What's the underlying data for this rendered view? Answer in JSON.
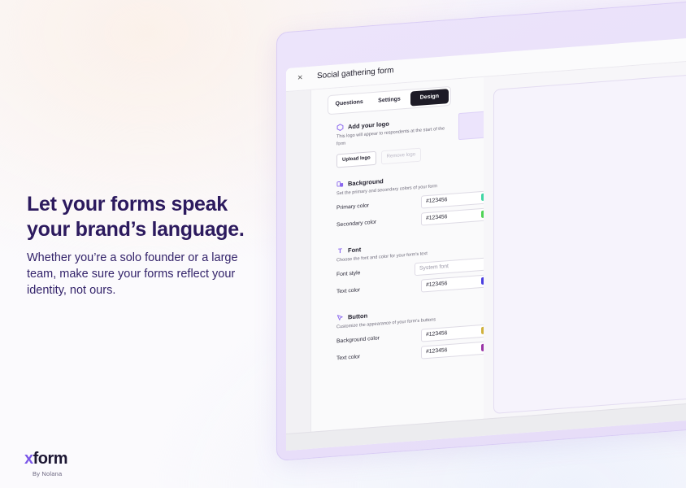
{
  "marketing": {
    "headline_line1": "Let your forms speak",
    "headline_line2": "your brand’s language.",
    "subcopy": "Whether you’re a solo founder or a large team, make sure your forms reflect your identity, not ours."
  },
  "brand": {
    "logo_x": "x",
    "logo_rest": "form",
    "by_text": "By Nolana"
  },
  "window": {
    "close_icon": "×",
    "title": "Social gathering form"
  },
  "tabs": [
    {
      "label": "Questions",
      "active": false
    },
    {
      "label": "Settings",
      "active": false
    },
    {
      "label": "Design",
      "active": true
    }
  ],
  "logo_section": {
    "title": "Add your logo",
    "description": "This logo will appear to respondents at the start of the form",
    "upload_label": "Upload logo",
    "remove_label": "Remove logo"
  },
  "background_section": {
    "title": "Background",
    "description": "Set the primary and secondary colors of your form",
    "primary_label": "Primary color",
    "primary_value": "#123456",
    "primary_swatch": "#3fd6a4",
    "secondary_label": "Secondary color",
    "secondary_value": "#123456",
    "secondary_swatch": "#4fd456"
  },
  "font_section": {
    "title": "Font",
    "description": "Choose the font and color for your form's text",
    "style_label": "Font style",
    "style_value": "System font",
    "color_label": "Text color",
    "color_value": "#123456",
    "color_swatch": "#4a3ee0"
  },
  "button_section": {
    "title": "Button",
    "description": "Customize the appearance of your form's buttons",
    "bg_label": "Background color",
    "bg_value": "#123456",
    "bg_swatch": "#d0b13c",
    "text_label": "Text color",
    "text_value": "#123456",
    "text_swatch": "#9a33a6"
  },
  "icons": {
    "logo": "hexagon-icon",
    "background": "palette-icon",
    "font": "text-icon",
    "button": "cursor-icon",
    "chevron": "chevron-down-icon"
  }
}
